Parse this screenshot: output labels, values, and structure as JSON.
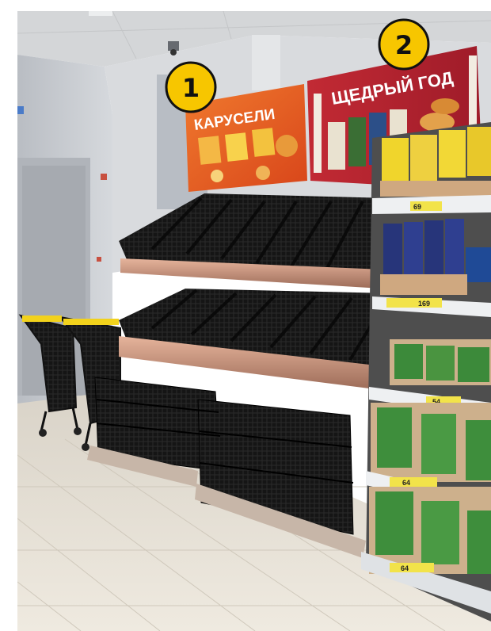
{
  "photo": {
    "subject": "store-bakery-section",
    "markers": [
      {
        "label": "1"
      },
      {
        "label": "2"
      }
    ],
    "signs": {
      "left": {
        "title": "КАРУСЕЛИ"
      },
      "right": {
        "title": "ЩЕДРЫЙ ГОД"
      }
    },
    "price_tags": {
      "shelf1": "69",
      "shelf2": "169",
      "shelf3": "54",
      "shelf4": "64",
      "shelf5": "64"
    },
    "colors": {
      "marker_fill": "#f7c600",
      "left_sign": "#e0531e",
      "right_sign": "#b3202e",
      "tag_yellow": "#f2e34a"
    }
  }
}
